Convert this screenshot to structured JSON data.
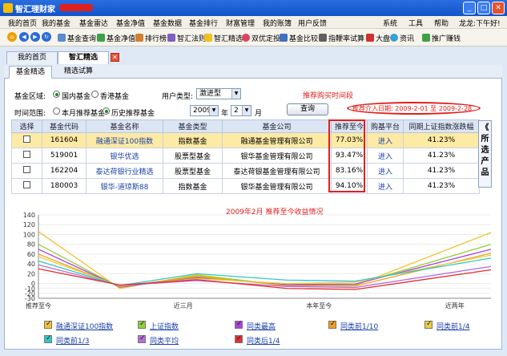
{
  "window": {
    "title": "智汇理财家"
  },
  "menu": [
    "我的首页",
    "我的基金",
    "基金雷达",
    "基金净值",
    "基金数据",
    "基金排行",
    "财富管理",
    "我的账簿",
    "用户反馈",
    "系统",
    "工具",
    "帮助"
  ],
  "user_greeting": "龙龙:下午好!",
  "toolbar": [
    "基金查询",
    "基金净值",
    "排行榜",
    "智汇法则",
    "智汇精选",
    "双优定投",
    "基金比较",
    "指鞭率试算",
    "大盘",
    "资讯",
    "推广赚钱"
  ],
  "doc_tabs": [
    "我的首页",
    "智汇精选"
  ],
  "sub_tabs": [
    "基金精选",
    "精选试算"
  ],
  "filters": {
    "region_label": "基金区域:",
    "region_options": [
      "国内基金",
      "香港基金"
    ],
    "user_type_label": "用户类型:",
    "user_type_value": "激进型",
    "time_label": "时间范围:",
    "time_options": [
      "本月推荐基金",
      "历史推荐基金"
    ],
    "year": "2009",
    "year_unit": "年",
    "month": "2",
    "month_unit": "月",
    "query_button": "查询"
  },
  "annotations": {
    "buy_time": "推荐购买时间段",
    "date_range": "推荐介入日期: 2009-2-01 至 2009-2-28",
    "chart_note": "2009年2月 推荐至今收益情况"
  },
  "table": {
    "headers": [
      "选择",
      "基金代码",
      "基金名称",
      "基金类型",
      "基金公司",
      "推荐至今",
      "购基平台",
      "同期上证指数涨跌幅"
    ],
    "rows": [
      {
        "code": "161604",
        "name": "融通深证100指数",
        "type": "指数基金",
        "company": "融通基金管理有限公司",
        "since": "77.03%",
        "platform": "进入",
        "index": "41.23%"
      },
      {
        "code": "519001",
        "name": "银华优选",
        "type": "股票型基金",
        "company": "银华基金管理有限公司",
        "since": "93.47%",
        "platform": "进入",
        "index": "41.23%"
      },
      {
        "code": "162204",
        "name": "泰达荷银行业精选",
        "type": "股票型基金",
        "company": "泰达荷银基金管理有限公司",
        "since": "83.16%",
        "platform": "进入",
        "index": "41.23%"
      },
      {
        "code": "180003",
        "name": "银华-道琼斯88",
        "type": "指数基金",
        "company": "银华基金管理有限公司",
        "since": "94.10%",
        "platform": "进入",
        "index": "41.23%"
      }
    ]
  },
  "side_button": "所选产品",
  "side_arrow": "《",
  "chart_data": {
    "type": "line",
    "categories": [
      "推荐至今",
      "近三月",
      "本年至今",
      "近两年"
    ],
    "ylim": [
      -30,
      140
    ],
    "yticks": [
      140,
      120,
      100,
      80,
      60,
      40,
      20,
      0,
      -10,
      -20,
      -30
    ],
    "series": [
      {
        "name": "融通深证100指数",
        "color": "#f2c230",
        "values": [
          106,
          -10,
          18,
          -5,
          -4,
          104
        ]
      },
      {
        "name": "上证指数",
        "color": "#8fd03a",
        "values": [
          80,
          -8,
          16,
          -3,
          -2,
          80
        ]
      },
      {
        "name": "同类最高",
        "color": "#b040d8",
        "values": [
          70,
          -7,
          12,
          -2,
          -1,
          70
        ]
      },
      {
        "name": "同类前1/10",
        "color": "#f0a020",
        "values": [
          60,
          -6,
          14,
          -4,
          -5,
          62
        ]
      },
      {
        "name": "同类前1/4",
        "color": "#e8d040",
        "values": [
          55,
          -5,
          10,
          0,
          3,
          58
        ]
      },
      {
        "name": "同类前1/3",
        "color": "#30c8c8",
        "values": [
          46,
          -4,
          20,
          7,
          5,
          52
        ]
      },
      {
        "name": "同类平均",
        "color": "#b86ad8",
        "values": [
          38,
          -4,
          6,
          -6,
          -8,
          35
        ]
      },
      {
        "name": "同类后1/4",
        "color": "#e03030",
        "values": [
          30,
          -3,
          8,
          -10,
          -12,
          28
        ]
      }
    ],
    "x_positions": [
      0,
      0.18,
      0.35,
      0.55,
      0.7,
      1.0
    ]
  },
  "legend": [
    "融通深证100指数",
    "上证指数",
    "同类最高",
    "同类前1/10",
    "同类前1/4",
    "同类前1/3",
    "同类平均",
    "同类后1/4"
  ]
}
